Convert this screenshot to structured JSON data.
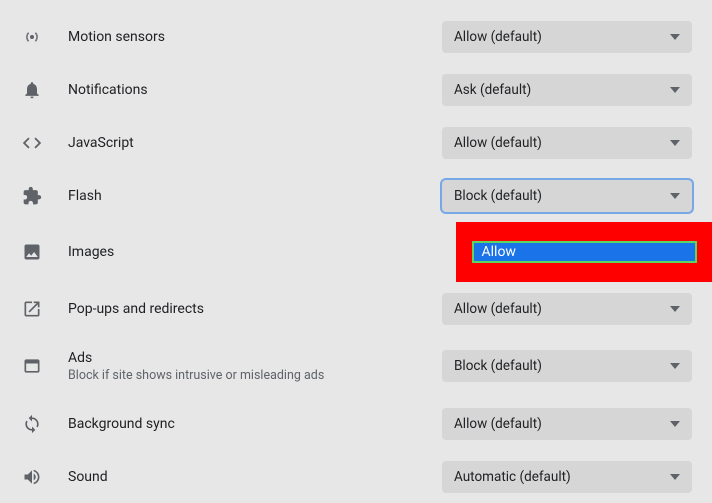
{
  "settings": {
    "motionSensors": {
      "label": "Motion sensors",
      "value": "Allow (default)"
    },
    "notifications": {
      "label": "Notifications",
      "value": "Ask (default)"
    },
    "javascript": {
      "label": "JavaScript",
      "value": "Allow (default)"
    },
    "flash": {
      "label": "Flash",
      "value": "Block (default)"
    },
    "images": {
      "label": "Images",
      "highlightedOption": "Allow"
    },
    "popups": {
      "label": "Pop-ups and redirects",
      "value": "Allow (default)"
    },
    "ads": {
      "label": "Ads",
      "sublabel": "Block if site shows intrusive or misleading ads",
      "value": "Block (default)"
    },
    "backgroundSync": {
      "label": "Background sync",
      "value": "Allow (default)"
    },
    "sound": {
      "label": "Sound",
      "value": "Automatic (default)"
    }
  }
}
